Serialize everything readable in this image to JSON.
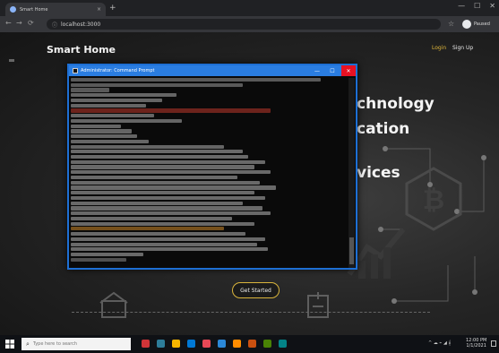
{
  "browser": {
    "tab_title": "Smart Home",
    "tab_close": "×",
    "new_tab": "+",
    "address": "localhost:3000",
    "back": "←",
    "forward": "→",
    "reload": "⟳",
    "star": "☆",
    "window_controls": [
      "—",
      "☐",
      "✕"
    ],
    "profile_name": "Paused"
  },
  "site": {
    "brand": "Smart Home",
    "nav": {
      "login": "Login",
      "signup": "Sign Up"
    },
    "hero_lines": [
      "chnology",
      "cation",
      "vices"
    ],
    "hero_button": "Get Started"
  },
  "terminal": {
    "title": "Administrator: Command Prompt",
    "minimize": "—",
    "maximize": "☐",
    "close": "✕",
    "lines": [
      {
        "w": 0.9,
        "c": "#9a9a9a"
      },
      {
        "w": 0.62,
        "c": "#9a9a9a"
      },
      {
        "w": 0.14,
        "c": "#9a9a9a"
      },
      {
        "w": 0.38,
        "c": "#b0b0b0"
      },
      {
        "w": 0.33,
        "c": "#b0b0b0"
      },
      {
        "w": 0.27,
        "c": "#b0b0b0"
      },
      {
        "w": 0.72,
        "c": "#c0392b"
      },
      {
        "w": 0.3,
        "c": "#b0b0b0"
      },
      {
        "w": 0.4,
        "c": "#b0b0b0"
      },
      {
        "w": 0.18,
        "c": "#b0b0b0"
      },
      {
        "w": 0.22,
        "c": "#b0b0b0"
      },
      {
        "w": 0.24,
        "c": "#b0b0b0"
      },
      {
        "w": 0.28,
        "c": "#b0b0b0"
      },
      {
        "w": 0.55,
        "c": "#b0b0b0"
      },
      {
        "w": 0.62,
        "c": "#b8b8b8"
      },
      {
        "w": 0.64,
        "c": "#b8b8b8"
      },
      {
        "w": 0.7,
        "c": "#b8b8b8"
      },
      {
        "w": 0.66,
        "c": "#b8b8b8"
      },
      {
        "w": 0.72,
        "c": "#b8b8b8"
      },
      {
        "w": 0.6,
        "c": "#b8b8b8"
      },
      {
        "w": 0.68,
        "c": "#b8b8b8"
      },
      {
        "w": 0.74,
        "c": "#b8b8b8"
      },
      {
        "w": 0.66,
        "c": "#b8b8b8"
      },
      {
        "w": 0.7,
        "c": "#b8b8b8"
      },
      {
        "w": 0.62,
        "c": "#b8b8b8"
      },
      {
        "w": 0.69,
        "c": "#b8b8b8"
      },
      {
        "w": 0.72,
        "c": "#b8b8b8"
      },
      {
        "w": 0.58,
        "c": "#b8b8b8"
      },
      {
        "w": 0.66,
        "c": "#b8b8b8"
      },
      {
        "w": 0.55,
        "c": "#d08a2c"
      },
      {
        "w": 0.63,
        "c": "#b8b8b8"
      },
      {
        "w": 0.7,
        "c": "#b8b8b8"
      },
      {
        "w": 0.67,
        "c": "#b8b8b8"
      },
      {
        "w": 0.71,
        "c": "#b8b8b8"
      },
      {
        "w": 0.26,
        "c": "#b8b8b8"
      },
      {
        "w": 0.2,
        "c": "#8a8a8a"
      }
    ]
  },
  "taskbar": {
    "search_placeholder": "Type here to search",
    "search_icon": "⌕",
    "pinned": [
      "#d13438",
      "#2d7d9a",
      "#f7b500",
      "#0078d4",
      "#e74856",
      "#2b88d8",
      "#ff8c00",
      "#ca5010",
      "#498205",
      "#038387"
    ],
    "tray": "^ ☁ ⌁ ◢ 𝄞",
    "time": "12:00 PM",
    "date": "1/1/2021"
  },
  "colors": {
    "accent_gold": "#e0b73a",
    "terminal_border": "#1d6fd4"
  }
}
